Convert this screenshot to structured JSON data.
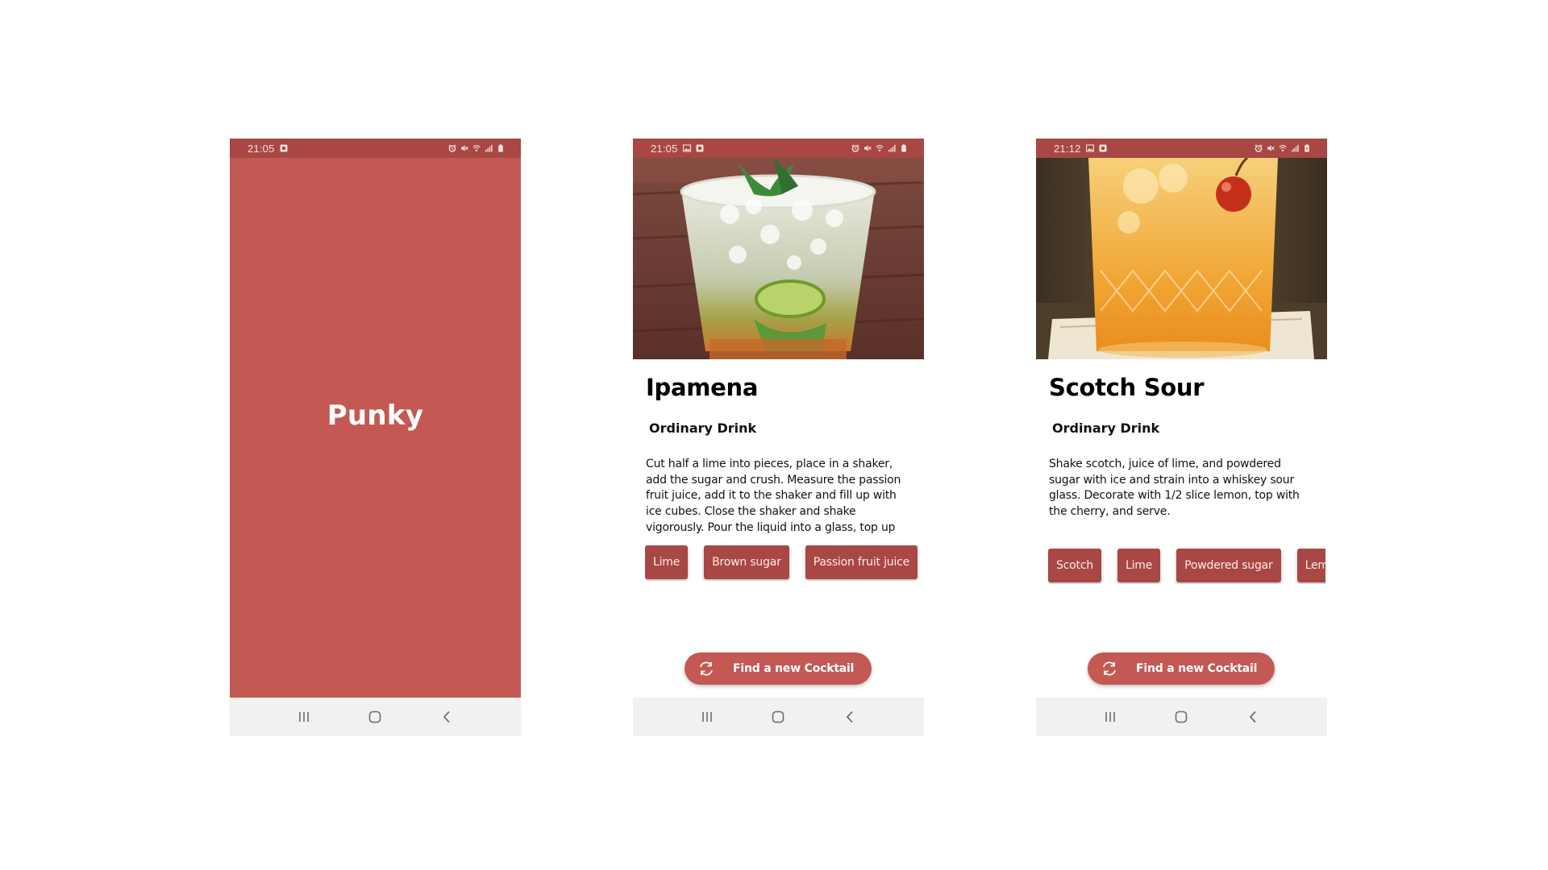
{
  "colors": {
    "primary": "#c45852",
    "primary_dark": "#a84743",
    "navbar": "#f1f1f1",
    "chip_text": "#fbeceb"
  },
  "screens": [
    {
      "status_time": "21:05",
      "status_left_icons": [
        "notification-icon"
      ],
      "status_right_icons": [
        "alarm-icon",
        "mute-icon",
        "wifi-icon",
        "signal-icon",
        "battery-icon"
      ],
      "splash_title": "Punky"
    },
    {
      "status_time": "21:05",
      "status_left_icons": [
        "image-icon",
        "notification-icon"
      ],
      "status_right_icons": [
        "alarm-icon",
        "mute-icon",
        "wifi-icon",
        "signal-icon",
        "battery-icon"
      ],
      "photo": "mojito-glass-photo",
      "title": "Ipamena",
      "category": "Ordinary Drink",
      "instructions": "Cut half a lime into pieces, place in a shaker, add the sugar and crush. Measure the passion fruit juice, add it to the shaker and fill up with ice cubes. Close the shaker and shake vigorously. Pour the liquid into a glass, top up",
      "ingredients": [
        "Lime",
        "Brown sugar",
        "Passion fruit juice"
      ],
      "find_button": "Find a new Cocktail"
    },
    {
      "status_time": "21:12",
      "status_left_icons": [
        "image-icon",
        "notification-icon"
      ],
      "status_right_icons": [
        "alarm-icon",
        "mute-icon",
        "wifi-icon",
        "signal-icon",
        "battery-charging-icon"
      ],
      "photo": "scotch-sour-glass-photo",
      "title": "Scotch Sour",
      "category": "Ordinary Drink",
      "instructions": "Shake scotch, juice of lime, and powdered sugar with ice and strain into a whiskey sour glass. Decorate with 1/2 slice lemon, top with the cherry, and serve.",
      "ingredients": [
        "Scotch",
        "Lime",
        "Powdered sugar",
        "Lemon"
      ],
      "find_button": "Find a new Cocktail"
    }
  ],
  "navbar": {
    "icons": [
      "recent-apps-icon",
      "home-icon",
      "back-icon"
    ]
  }
}
